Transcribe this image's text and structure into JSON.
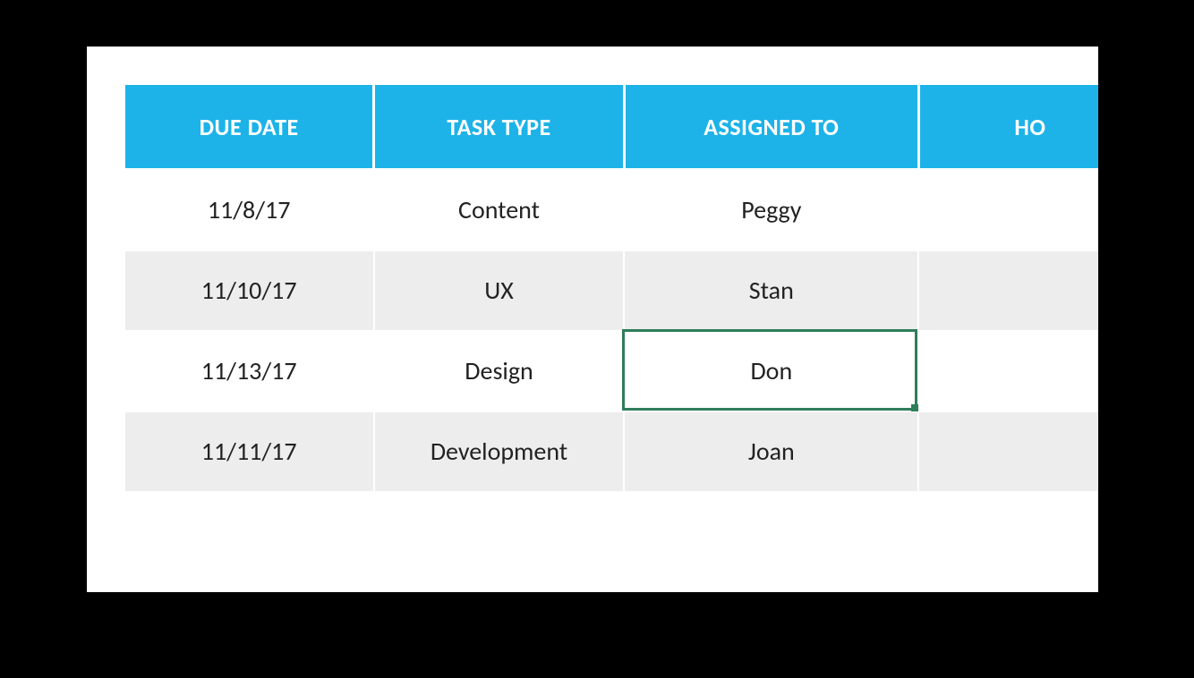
{
  "table": {
    "headers": {
      "due_date": "DUE DATE",
      "task_type": "TASK TYPE",
      "assigned_to": "ASSIGNED TO",
      "hours_partial": "HO"
    },
    "rows": [
      {
        "due_date": "11/8/17",
        "task_type": "Content",
        "assigned_to": "Peggy"
      },
      {
        "due_date": "11/10/17",
        "task_type": "UX",
        "assigned_to": "Stan"
      },
      {
        "due_date": "11/13/17",
        "task_type": "Design",
        "assigned_to": "Don"
      },
      {
        "due_date": "11/11/17",
        "task_type": "Development",
        "assigned_to": "Joan"
      }
    ],
    "selected_cell": {
      "row": 2,
      "col": "assigned_to"
    }
  }
}
